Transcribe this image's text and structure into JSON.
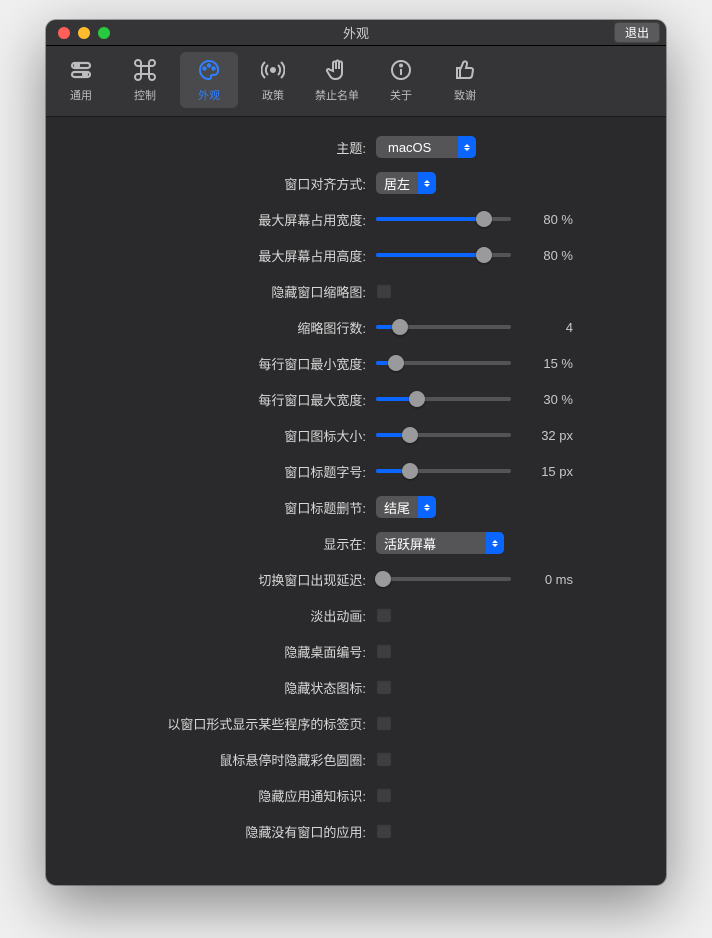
{
  "window": {
    "title": "外观"
  },
  "exit_button": "退出",
  "tabs": [
    {
      "label": "通用",
      "id": "general"
    },
    {
      "label": "控制",
      "id": "controls"
    },
    {
      "label": "外观",
      "id": "appearance"
    },
    {
      "label": "政策",
      "id": "policies"
    },
    {
      "label": "禁止名单",
      "id": "blocklist"
    },
    {
      "label": "关于",
      "id": "about"
    },
    {
      "label": "致谢",
      "id": "acknowledgements"
    }
  ],
  "active_tab": "appearance",
  "settings": {
    "theme": {
      "label": "主题:",
      "value": "macOS"
    },
    "window_align": {
      "label": "窗口对齐方式:",
      "value": "居左"
    },
    "max_width": {
      "label": "最大屏幕占用宽度:",
      "value": "80 %",
      "pct": 80
    },
    "max_height": {
      "label": "最大屏幕占用高度:",
      "value": "80 %",
      "pct": 80
    },
    "hide_thumb": {
      "label": "隐藏窗口缩略图:",
      "checked": false
    },
    "thumb_rows": {
      "label": "缩略图行数:",
      "value": "4",
      "pct": 18
    },
    "row_min_w": {
      "label": "每行窗口最小宽度:",
      "value": "15 %",
      "pct": 15
    },
    "row_max_w": {
      "label": "每行窗口最大宽度:",
      "value": "30 %",
      "pct": 30
    },
    "icon_size": {
      "label": "窗口图标大小:",
      "value": "32 px",
      "pct": 25
    },
    "title_size": {
      "label": "窗口标题字号:",
      "value": "15 px",
      "pct": 25
    },
    "title_trunc": {
      "label": "窗口标题删节:",
      "value": "结尾"
    },
    "show_on": {
      "label": "显示在:",
      "value": "活跃屏幕"
    },
    "switch_delay": {
      "label": "切换窗口出现延迟:",
      "value": "0 ms",
      "pct": 0
    },
    "fade_anim": {
      "label": "淡出动画:",
      "checked": false
    },
    "hide_desk_num": {
      "label": "隐藏桌面编号:",
      "checked": false
    },
    "hide_status_icon": {
      "label": "隐藏状态图标:",
      "checked": false
    },
    "tabs_as_windows": {
      "label": "以窗口形式显示某些程序的标签页:",
      "checked": false
    },
    "hide_hover_circle": {
      "label": "鼠标悬停时隐藏彩色圆圈:",
      "checked": false
    },
    "hide_notif_badge": {
      "label": "隐藏应用通知标识:",
      "checked": false
    },
    "hide_no_window_app": {
      "label": "隐藏没有窗口的应用:",
      "checked": false
    }
  }
}
